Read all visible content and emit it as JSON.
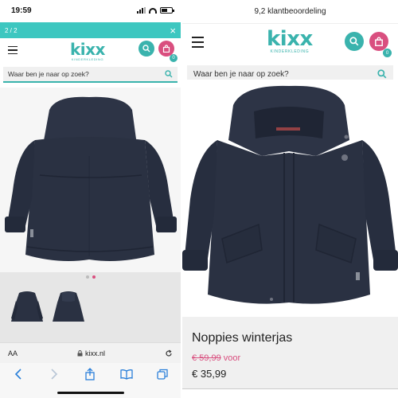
{
  "left": {
    "status": {
      "time": "19:59"
    },
    "gallery": {
      "counter": "2 / 2",
      "close": "×"
    },
    "logo": {
      "name": "kixx",
      "tagline": "KINDERKLEDING"
    },
    "cart_count": "0",
    "search": {
      "placeholder": "Waar ben je naar op zoek?"
    },
    "browser": {
      "text_size": "AA",
      "url": "kixx.nl"
    }
  },
  "right": {
    "rating": "9,2 klantbeoordeling",
    "logo": {
      "name": "kixx",
      "tagline": "KINDERKLEDING"
    },
    "cart_count": "0",
    "search": {
      "placeholder": "Waar ben je naar op zoek?"
    },
    "product": {
      "title": "Noppies winterjas",
      "old_price": "€ 59,99",
      "old_price_suffix": "voor",
      "new_price": "€ 35,99"
    }
  },
  "colors": {
    "brand_teal": "#3ab3ad",
    "accent_pink": "#d94f7f",
    "jacket_navy": "#2a3142"
  }
}
